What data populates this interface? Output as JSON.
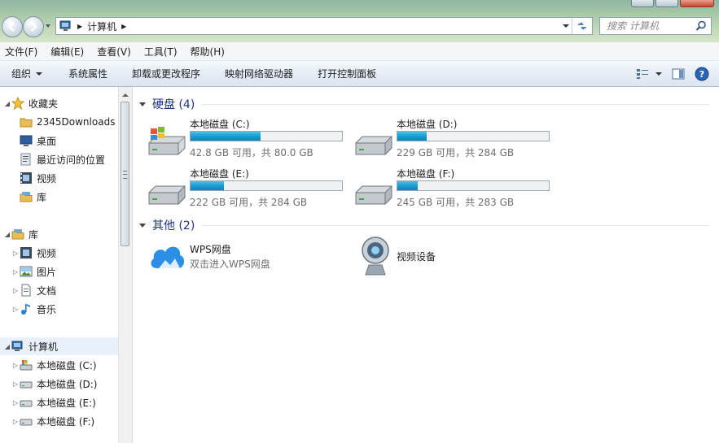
{
  "address": {
    "crumbs": [
      "计算机"
    ]
  },
  "search": {
    "placeholder": "搜索 计算机"
  },
  "menu": [
    "文件(F)",
    "编辑(E)",
    "查看(V)",
    "工具(T)",
    "帮助(H)"
  ],
  "toolbar": {
    "organize": "组织",
    "buttons": [
      "系统属性",
      "卸载或更改程序",
      "映射网络驱动器",
      "打开控制面板"
    ]
  },
  "sidebar": {
    "favorites": {
      "label": "收藏夹",
      "items": [
        "2345Downloads",
        "桌面",
        "最近访问的位置",
        "视频",
        "库"
      ]
    },
    "libraries": {
      "label": "库",
      "items": [
        "视频",
        "图片",
        "文档",
        "音乐"
      ]
    },
    "computer": {
      "label": "计算机",
      "items": [
        "本地磁盘 (C:)",
        "本地磁盘 (D:)",
        "本地磁盘 (E:)",
        "本地磁盘 (F:)"
      ]
    }
  },
  "content": {
    "drives_group": "硬盘 (4)",
    "drives": [
      {
        "name": "本地磁盘 (C:)",
        "free": "42.8 GB 可用，共 80.0 GB",
        "used_fraction": 0.465
      },
      {
        "name": "本地磁盘 (D:)",
        "free": "229 GB 可用，共 284 GB",
        "used_fraction": 0.194
      },
      {
        "name": "本地磁盘 (E:)",
        "free": "222 GB 可用，共 284 GB",
        "used_fraction": 0.218
      },
      {
        "name": "本地磁盘 (F:)",
        "free": "245 GB 可用，共 283 GB",
        "used_fraction": 0.134
      }
    ],
    "other_group": "其他 (2)",
    "others": [
      {
        "name": "WPS网盘",
        "sub": "双击进入WPS网盘"
      },
      {
        "name": "视频设备"
      }
    ]
  },
  "colors": {
    "bar_fill": "#1e9bd1",
    "group_title": "#1e3287",
    "toolbar_bg": "#e3ebf4"
  }
}
